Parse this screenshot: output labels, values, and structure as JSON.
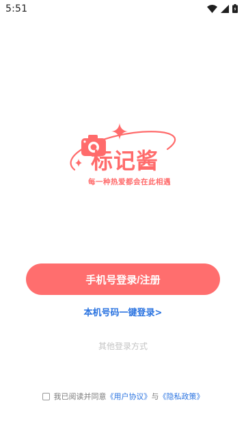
{
  "status_bar": {
    "time": "5:51",
    "icons": [
      "wifi-icon",
      "cell-signal-icon",
      "battery-icon"
    ]
  },
  "logo": {
    "title": "标记酱",
    "slogan": "每一种热爱都会在此相遇",
    "icons": [
      "camera-icon",
      "sparkle-icon",
      "orbit-ring"
    ]
  },
  "login": {
    "phone_button": "手机号登录/注册",
    "one_click": "本机号码一键登录>",
    "other_methods": "其他登录方式"
  },
  "agreement": {
    "prefix": "我已阅读并同意",
    "user_agreement": "《用户协议》",
    "and": "与",
    "privacy_policy": "《隐私政策》",
    "checked": false
  },
  "colors": {
    "brand": "#ff6b6b",
    "button": "#ff6e6e",
    "link": "#2a73e0"
  }
}
